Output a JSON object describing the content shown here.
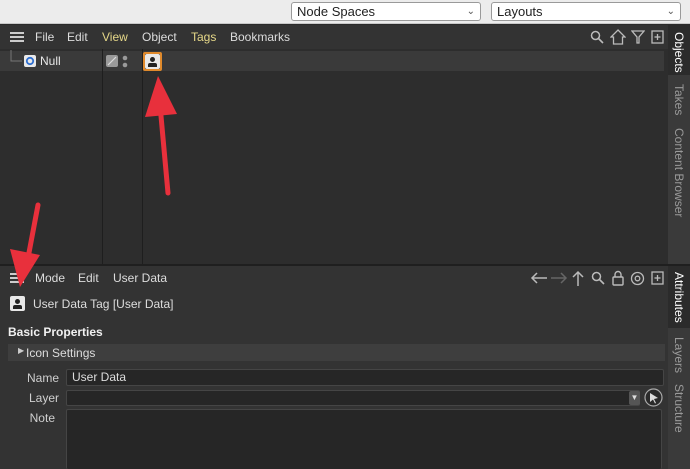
{
  "topbar": {
    "node_spaces": "Node Spaces",
    "layouts": "Layouts"
  },
  "objects_panel": {
    "menu": [
      "File",
      "Edit",
      "View",
      "Object",
      "Tags",
      "Bookmarks"
    ],
    "object_name": "Null",
    "toolbar_icons": [
      "search-icon",
      "home-icon",
      "filter-icon",
      "new-panel-icon"
    ]
  },
  "right_tabs_top": [
    "Objects",
    "Takes",
    "Content Browser"
  ],
  "right_tabs_bottom": [
    "Attributes",
    "Layers",
    "Structure"
  ],
  "attributes": {
    "menu": [
      "Mode",
      "Edit",
      "User Data"
    ],
    "title": "User Data Tag [User Data]",
    "section_title": "Basic Properties",
    "group_title": "Icon Settings",
    "name_label": "Name",
    "name_value": "User Data",
    "layer_label": "Layer",
    "layer_value": "",
    "note_label": "Note",
    "note_value": "",
    "toolbar_icons": [
      "back-arrow-icon",
      "forward-arrow-icon",
      "up-arrow-icon",
      "search-icon",
      "lock-icon",
      "target-icon",
      "new-panel-icon"
    ]
  },
  "annotations": {
    "arrow_color": "#e8303c"
  },
  "colors": {
    "menu_highlight": "#e6d889",
    "tag_selection": "#e08a2c"
  }
}
